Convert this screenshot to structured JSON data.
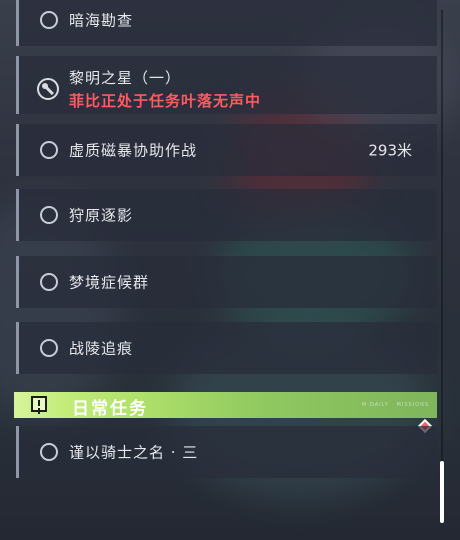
{
  "quests": [
    {
      "label": "暗海勘查"
    },
    {
      "label": "黎明之星（一）",
      "warning": "菲比正处于任务叶落无声中"
    },
    {
      "label": "虚质磁暴协助作战",
      "distance": "293米"
    },
    {
      "label": "狩原逐影"
    },
    {
      "label": "梦境症候群"
    },
    {
      "label": "战陵追痕"
    }
  ],
  "daily_section": {
    "title": "日常任务",
    "tag": "M DAILY · MISSIONS"
  },
  "daily_quests": [
    {
      "label": "谨以骑士之名 · 三"
    }
  ]
}
